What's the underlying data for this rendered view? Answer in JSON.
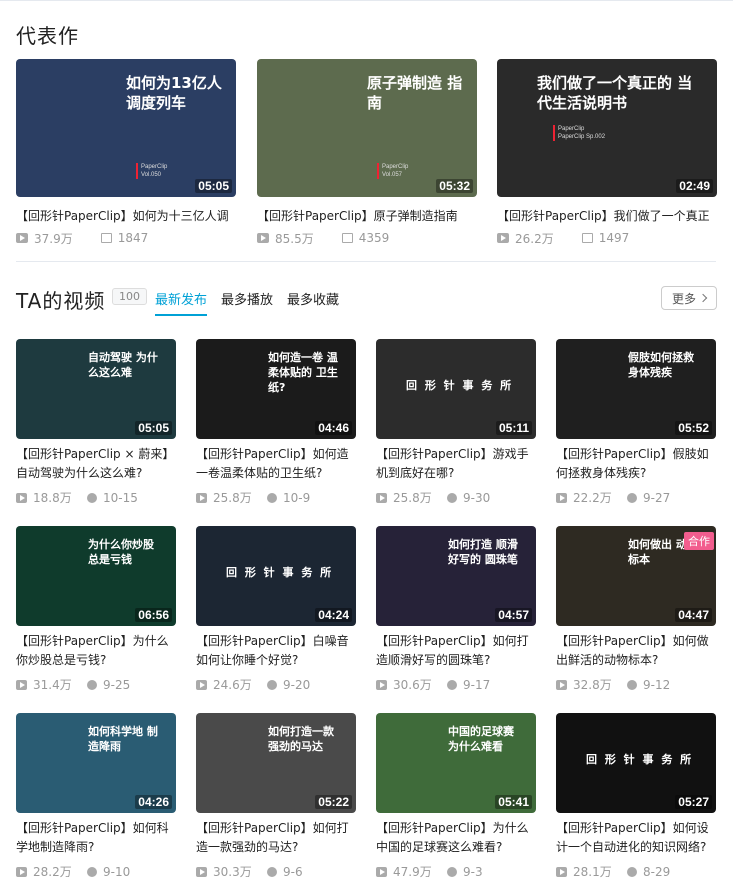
{
  "sections": {
    "featured_title": "代表作",
    "videos_title": "TA的视频",
    "video_count": "100",
    "tabs": [
      "最新发布",
      "最多播放",
      "最多收藏"
    ],
    "more_label": "更多"
  },
  "featured": [
    {
      "title": "【回形针PaperClip】如何为十三亿人调",
      "views": "37.9万",
      "favs": "1847",
      "duration": "05:05",
      "overlay": "如何为13亿人 调度列车",
      "vol": "Vol.050",
      "bg": "#2b3e63"
    },
    {
      "title": "【回形针PaperClip】原子弹制造指南",
      "views": "85.5万",
      "favs": "4359",
      "duration": "05:32",
      "overlay": "原子弹制造 指南",
      "vol": "Vol.057",
      "bg": "#5d6b4e"
    },
    {
      "title": "【回形针PaperClip】我们做了一个真正",
      "views": "26.2万",
      "favs": "1497",
      "duration": "02:49",
      "overlay": "我们做了一个真正的 当代生活说明书",
      "vol": "PaperClip Sp.002",
      "bg": "#2a2a2a"
    }
  ],
  "videos": [
    {
      "title": "【回形针PaperClip × 蔚来】自动驾驶为什么这么难?",
      "views": "18.8万",
      "date": "10-15",
      "duration": "05:05",
      "overlay": "自动驾驶 为什么这么难",
      "bg": "#1e3a3f"
    },
    {
      "title": "【回形针PaperClip】如何造一卷温柔体贴的卫生纸?",
      "views": "25.8万",
      "date": "10-9",
      "duration": "04:46",
      "overlay": "如何造一卷 温柔体贴的 卫生纸?",
      "bg": "#1b1b1b"
    },
    {
      "title": "【回形针PaperClip】游戏手机到底好在哪?",
      "views": "25.8万",
      "date": "9-30",
      "duration": "05:11",
      "overlay": "回 形 针 事 务 所",
      "bg": "#2c2c2c"
    },
    {
      "title": "【回形针PaperClip】假肢如何拯救身体残疾?",
      "views": "22.2万",
      "date": "9-27",
      "duration": "05:52",
      "overlay": "假肢如何拯救 身体残疾",
      "bg": "#1f1f1f"
    },
    {
      "title": "【回形针PaperClip】为什么你炒股总是亏钱?",
      "views": "31.4万",
      "date": "9-25",
      "duration": "06:56",
      "overlay": "为什么你炒股 总是亏钱",
      "bg": "#0f3b2c"
    },
    {
      "title": "【回形针PaperClip】白噪音如何让你睡个好觉?",
      "views": "24.6万",
      "date": "9-20",
      "duration": "04:24",
      "overlay": "回 形 针 事 务 所",
      "bg": "#1c2633"
    },
    {
      "title": "【回形针PaperClip】如何打造顺滑好写的圆珠笔?",
      "views": "30.6万",
      "date": "9-17",
      "duration": "04:57",
      "overlay": "如何打造 顺滑好写的 圆珠笔",
      "bg": "#262238"
    },
    {
      "title": "【回形针PaperClip】如何做出鲜活的动物标本?",
      "views": "32.8万",
      "date": "9-12",
      "duration": "04:47",
      "overlay": "如何做出 动物标本",
      "badge": "合作",
      "bg": "#2e2a22"
    },
    {
      "title": "【回形针PaperClip】如何科学地制造降雨?",
      "views": "28.2万",
      "date": "9-10",
      "duration": "04:26",
      "overlay": "如何科学地 制造降雨",
      "bg": "#2a5c73"
    },
    {
      "title": "【回形针PaperClip】如何打造一款强劲的马达?",
      "views": "30.3万",
      "date": "9-6",
      "duration": "05:22",
      "overlay": "如何打造一款 强劲的马达",
      "bg": "#4a4a4a"
    },
    {
      "title": "【回形针PaperClip】为什么中国的足球赛这么难看?",
      "views": "47.9万",
      "date": "9-3",
      "duration": "05:41",
      "overlay": "中国的足球赛 为什么难看",
      "bg": "#3f6b3a"
    },
    {
      "title": "【回形针PaperClip】如何设计一个自动进化的知识网络?",
      "views": "28.1万",
      "date": "8-29",
      "duration": "05:27",
      "overlay": "回 形 针 事 务 所",
      "bg": "#111111"
    }
  ]
}
